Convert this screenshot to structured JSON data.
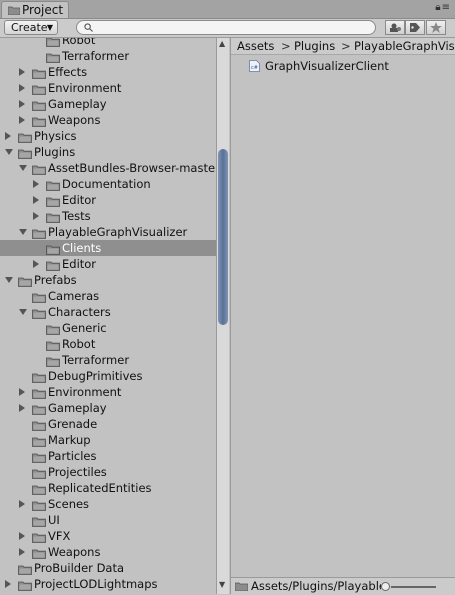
{
  "window": {
    "tab_title": "Project"
  },
  "toolbar": {
    "create_label": "Create"
  },
  "tree": [
    {
      "label": "Robot",
      "indent": 3,
      "fold": "none"
    },
    {
      "label": "Terraformer",
      "indent": 3,
      "fold": "none"
    },
    {
      "label": "Effects",
      "indent": 2,
      "fold": "closed"
    },
    {
      "label": "Environment",
      "indent": 2,
      "fold": "closed"
    },
    {
      "label": "Gameplay",
      "indent": 2,
      "fold": "closed"
    },
    {
      "label": "Weapons",
      "indent": 2,
      "fold": "closed"
    },
    {
      "label": "Physics",
      "indent": 1,
      "fold": "closed"
    },
    {
      "label": "Plugins",
      "indent": 1,
      "fold": "open"
    },
    {
      "label": "AssetBundles-Browser-master",
      "indent": 2,
      "fold": "open"
    },
    {
      "label": "Documentation",
      "indent": 3,
      "fold": "closed"
    },
    {
      "label": "Editor",
      "indent": 3,
      "fold": "closed"
    },
    {
      "label": "Tests",
      "indent": 3,
      "fold": "closed"
    },
    {
      "label": "PlayableGraphVisualizer",
      "indent": 2,
      "fold": "open"
    },
    {
      "label": "Clients",
      "indent": 3,
      "fold": "none",
      "selected": true
    },
    {
      "label": "Editor",
      "indent": 3,
      "fold": "closed"
    },
    {
      "label": "Prefabs",
      "indent": 1,
      "fold": "open"
    },
    {
      "label": "Cameras",
      "indent": 2,
      "fold": "none"
    },
    {
      "label": "Characters",
      "indent": 2,
      "fold": "open"
    },
    {
      "label": "Generic",
      "indent": 3,
      "fold": "none"
    },
    {
      "label": "Robot",
      "indent": 3,
      "fold": "none"
    },
    {
      "label": "Terraformer",
      "indent": 3,
      "fold": "none"
    },
    {
      "label": "DebugPrimitives",
      "indent": 2,
      "fold": "none"
    },
    {
      "label": "Environment",
      "indent": 2,
      "fold": "closed"
    },
    {
      "label": "Gameplay",
      "indent": 2,
      "fold": "closed"
    },
    {
      "label": "Grenade",
      "indent": 2,
      "fold": "none"
    },
    {
      "label": "Markup",
      "indent": 2,
      "fold": "none"
    },
    {
      "label": "Particles",
      "indent": 2,
      "fold": "none"
    },
    {
      "label": "Projectiles",
      "indent": 2,
      "fold": "none"
    },
    {
      "label": "ReplicatedEntities",
      "indent": 2,
      "fold": "none"
    },
    {
      "label": "Scenes",
      "indent": 2,
      "fold": "closed"
    },
    {
      "label": "UI",
      "indent": 2,
      "fold": "none"
    },
    {
      "label": "VFX",
      "indent": 2,
      "fold": "closed"
    },
    {
      "label": "Weapons",
      "indent": 2,
      "fold": "closed"
    },
    {
      "label": "ProBuilder Data",
      "indent": 1,
      "fold": "none"
    },
    {
      "label": "ProjectLODLightmaps",
      "indent": 1,
      "fold": "closed"
    }
  ],
  "breadcrumb": [
    "Assets",
    "Plugins",
    "PlayableGraphVisualizer"
  ],
  "assets": [
    {
      "label": "GraphVisualizerClient",
      "icon": "csharp-script-icon"
    }
  ],
  "footer": {
    "path": "Assets/Plugins/PlayableGraphVisualizer/Clients"
  },
  "colors": {
    "selection": "#8f8f8f",
    "scroll_thumb": "#5a7096",
    "folder": "#8c8c8c"
  }
}
